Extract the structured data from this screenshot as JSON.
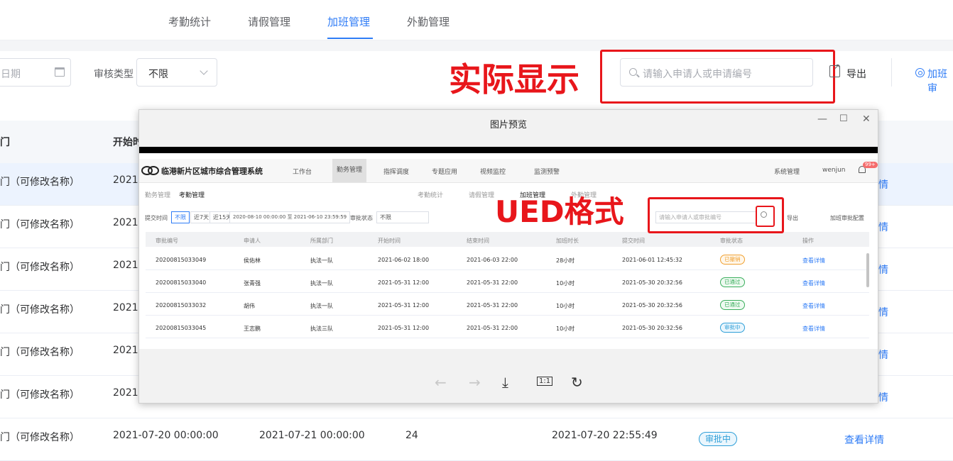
{
  "tabs": [
    "考勤统计",
    "请假管理",
    "加班管理",
    "外勤管理"
  ],
  "filters": {
    "date_placeholder": "日期",
    "audit_type_label": "审核类型",
    "audit_type_value": "不限",
    "search_placeholder": "请输入申请人或申请编号",
    "export_label": "导出",
    "config_label": "加班审"
  },
  "annotations": {
    "actual": "实际显示",
    "ued": "UED格式"
  },
  "table": {
    "headers": [
      "门",
      "开始时"
    ],
    "dept_cell": "门（可修改名称）",
    "start_prefix": "2021-",
    "link_text": "情",
    "last_row": {
      "dept": "门（可修改名称）",
      "start": "2021-07-20 00:00:00",
      "end": "2021-07-21 00:00:00",
      "hours": "24",
      "submit": "2021-07-20 22:55:49",
      "status": "审批中",
      "action": "查看详情"
    }
  },
  "preview": {
    "title": "图片预览",
    "controls": {
      "minimize": "—",
      "maximize": "☐",
      "close": "✕"
    },
    "toolbar": {
      "prev": "←",
      "next": "→",
      "download": "⤓",
      "actual_size": "1:1",
      "rotate": "↻"
    },
    "app": {
      "system_name": "临港新片区城市综合管理系统",
      "menu": [
        "工作台",
        "勤务管理",
        "指挥调度",
        "专题应用",
        "视频监控",
        "监测预警"
      ],
      "system_mgmt": "系统管理",
      "user": "wenjun",
      "notif_count": "99+",
      "breadcrumb_parent": "勤务管理",
      "breadcrumb_current": "考勤管理",
      "tabs": [
        "考勤统计",
        "请假管理",
        "加班管理",
        "外勤管理"
      ],
      "submit_time_label": "提交时间",
      "range_buttons": [
        "不限",
        "近7天",
        "近15天"
      ],
      "date_range": "2020-08-10 00:00:00 至 2021-06-10 23:59:59",
      "status_label": "审批状态",
      "status_value": "不限",
      "search_placeholder": "请输入申请人或审批编号",
      "export": "导出",
      "config": "加班审批配置",
      "headers": [
        "审批编号",
        "申请人",
        "所属部门",
        "开始时间",
        "结束时间",
        "加班时长",
        "提交时间",
        "审批状态",
        "操作"
      ],
      "rows": [
        {
          "id": "20200815033049",
          "name": "侯佑林",
          "dept": "执法一队",
          "start": "2021-06-02 18:00",
          "end": "2021-06-03 22:00",
          "dur": "28小时",
          "submit": "2021-06-01 12:45:32",
          "status": "已撤销",
          "action": "查看详情"
        },
        {
          "id": "20200815033040",
          "name": "张青强",
          "dept": "执法一队",
          "start": "2021-05-31 12:00",
          "end": "2021-05-31 22:00",
          "dur": "10小时",
          "submit": "2021-05-30 20:32:56",
          "status": "已通过",
          "action": "查看详情"
        },
        {
          "id": "20200815033032",
          "name": "胡伟",
          "dept": "执法一队",
          "start": "2021-05-31 12:00",
          "end": "2021-05-31 22:00",
          "dur": "10小时",
          "submit": "2021-05-30 20:32:56",
          "status": "已通过",
          "action": "查看详情"
        },
        {
          "id": "20200815033045",
          "name": "王志鹏",
          "dept": "执法三队",
          "start": "2021-05-31 12:00",
          "end": "2021-05-31 22:00",
          "dur": "10小时",
          "submit": "2021-05-30 20:32:56",
          "status": "审批中",
          "action": "查看详情"
        }
      ]
    }
  },
  "colors": {
    "accent": "#2f7cf6",
    "annotation_red": "#e8161b"
  }
}
